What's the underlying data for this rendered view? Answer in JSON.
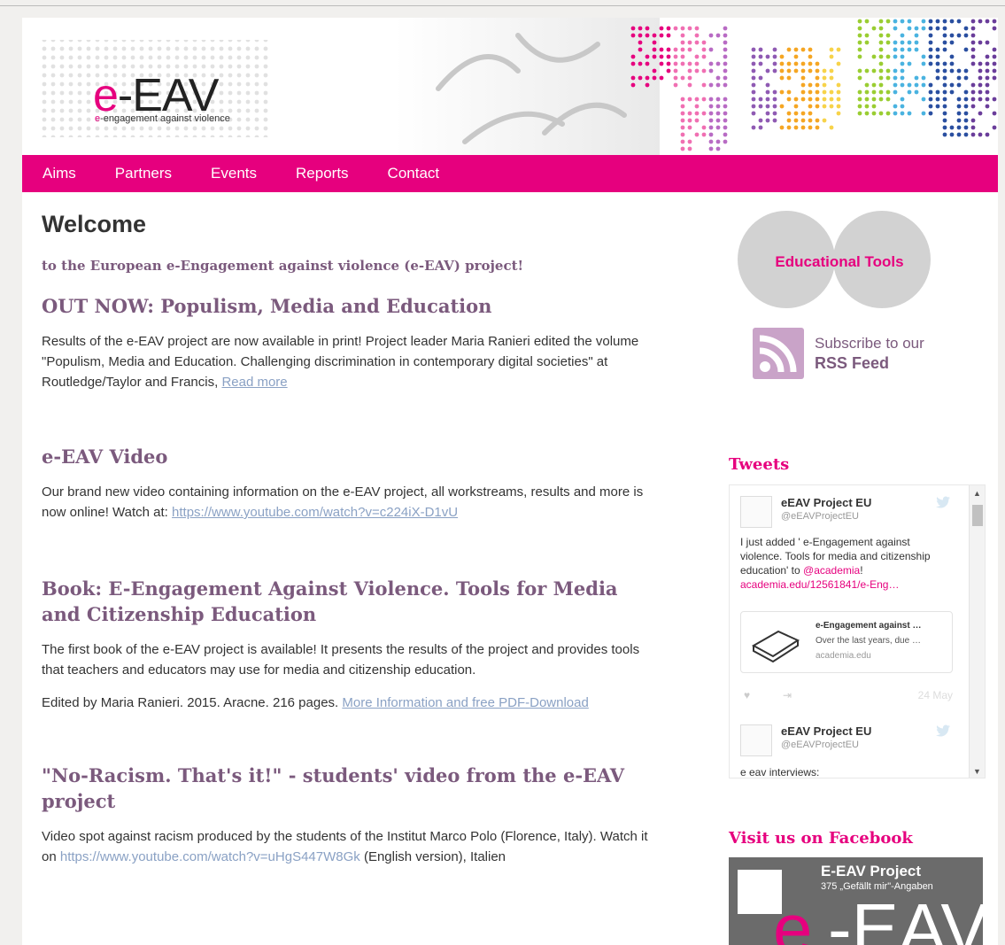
{
  "header": {
    "logo_prefix": "e",
    "logo_main": "-EAV",
    "tagline_prefix": "e",
    "tagline_rest": "-engagement against violence"
  },
  "nav": {
    "items": [
      "Aims",
      "Partners",
      "Events",
      "Reports",
      "Contact"
    ]
  },
  "colors": {
    "accent": "#e6007e",
    "heading": "#7b5a7d",
    "link": "#8aa1c4"
  },
  "main": {
    "title": "Welcome",
    "intro": "to the European e-Engagement against violence (e-EAV) project!",
    "articles": [
      {
        "heading": "OUT NOW: Populism, Media and Education",
        "paragraphs": [
          {
            "text": "Results of the e-EAV project are now available in print! Project leader Maria Ranieri edited the volume \"Populism, Media and Education. Challenging discrimination in contemporary digital societies\" at Routledge/Taylor and Francis, ",
            "link": "Read more"
          }
        ]
      },
      {
        "heading": "e-EAV Video",
        "paragraphs": [
          {
            "text": "Our brand new video containing information on the e-EAV project, all workstreams, results and more is now online! Watch at: ",
            "link": "https://www.youtube.com/watch?v=c224iX-D1vU"
          }
        ]
      },
      {
        "heading": "Book: E-Engagement Against Violence. Tools for Media and Citizenship Education",
        "paragraphs": [
          {
            "text": "The first book of the e-EAV project is available! It presents the results of the project and provides tools that teachers and educators may use for media and citizenship education.",
            "link": ""
          },
          {
            "text": "Edited by Maria Ranieri. 2015. Aracne. 216 pages. ",
            "link": "More Information and free PDF-Download"
          }
        ]
      },
      {
        "heading": "\"No-Racism. That's it!\" - students' video from the e-EAV project",
        "paragraphs": [
          {
            "text": "Video spot against racism produced by the students of the Institut Marco Polo (Florence, Italy). Watch it on ",
            "link": "https://www.youtube.com/watch?v=uHgS447W8Gk",
            "after": " (English version), Italien"
          }
        ]
      }
    ]
  },
  "sidebar": {
    "educational_tools": "Educational Tools",
    "rss_line1": "Subscribe to our",
    "rss_line2": "RSS Feed",
    "tweets_title": "Tweets",
    "tweets": [
      {
        "name": "eEAV Project EU",
        "handle": "@eEAVProjectEU",
        "text_before": "I just added ' e-Engagement against violence. Tools for media and citizenship education' to ",
        "mention": "@academia",
        "text_mid": "! ",
        "url": "academia.edu/12561841/e-Eng…",
        "card_title": "e-Engagement against …",
        "card_desc": "Over the last years, due …",
        "card_url": "academia.edu",
        "date": "24 May"
      },
      {
        "name": "eEAV Project EU",
        "handle": "@eEAVProjectEU",
        "text": "e eav interviews:"
      }
    ],
    "facebook_title": "Visit us on Facebook",
    "facebook_name": "E-EAV Project",
    "facebook_likes": "375 „Gefällt mir\"-Angaben"
  }
}
